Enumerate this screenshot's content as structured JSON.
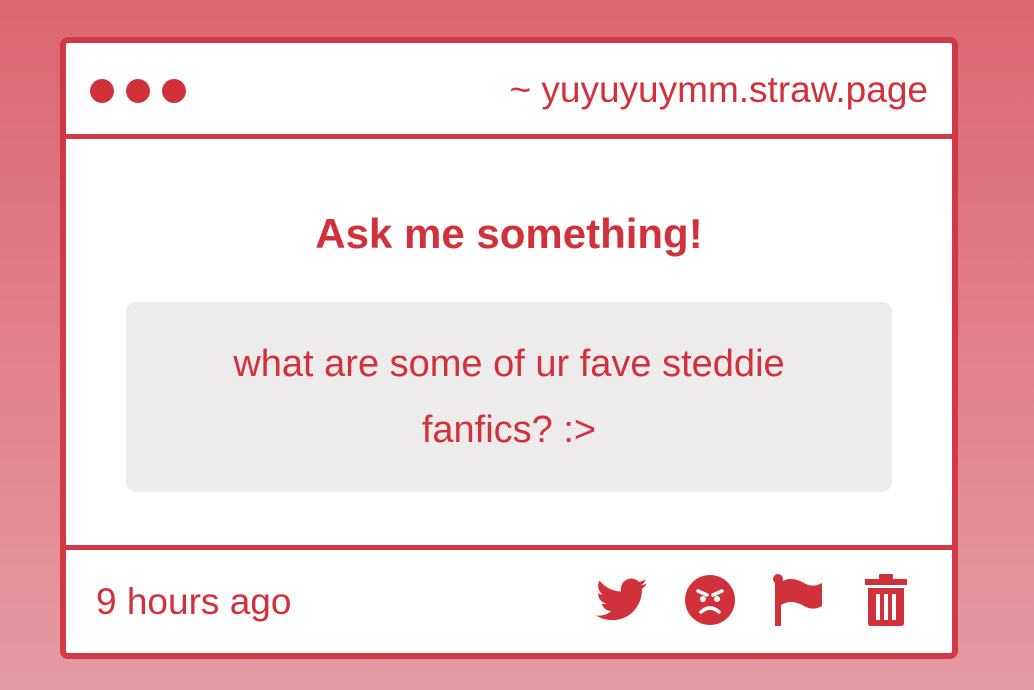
{
  "window": {
    "url": "~ yuyuyuymm.straw.page",
    "dots": [
      "dot",
      "dot",
      "dot"
    ]
  },
  "main": {
    "heading": "Ask me something!",
    "question": "what are some of ur fave steddie fanfics? :>"
  },
  "footer": {
    "timestamp": "9 hours ago",
    "actions": [
      {
        "icon": "twitter-bird-icon"
      },
      {
        "icon": "angry-face-icon"
      },
      {
        "icon": "flag-icon"
      },
      {
        "icon": "trash-icon"
      }
    ]
  },
  "colors": {
    "accent": "#d1313b",
    "background_top": "#dc6672",
    "background_bottom": "#e59aa2",
    "question_bg": "#eeebec"
  }
}
